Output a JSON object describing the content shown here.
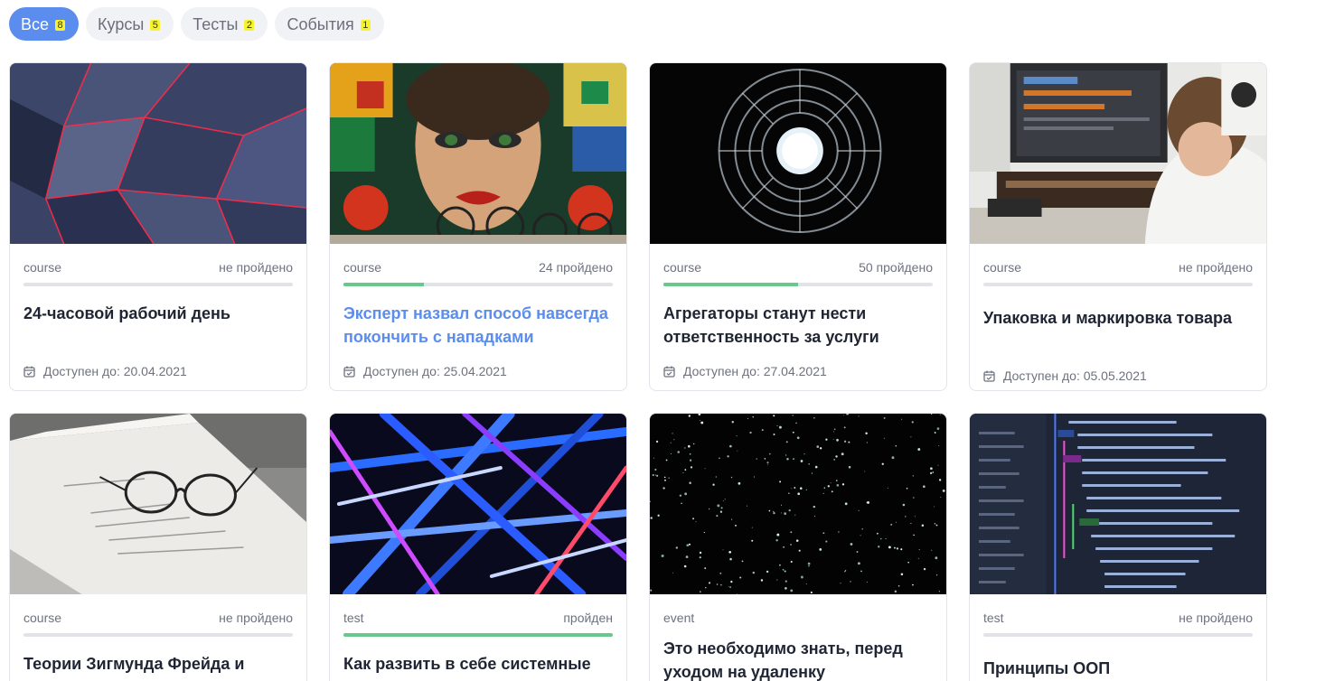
{
  "tabs": [
    {
      "label": "Все",
      "count": "8",
      "active": true
    },
    {
      "label": "Курсы",
      "count": "5"
    },
    {
      "label": "Тесты",
      "count": "2"
    },
    {
      "label": "События",
      "count": "1"
    }
  ],
  "cards": [
    {
      "type": "course",
      "status": "не пройдено",
      "progress": 0,
      "title": "24-часовой рабочий день",
      "date": "Доступен до: 20.04.2021",
      "image": "red-geometric-wall"
    },
    {
      "type": "course",
      "status": "24 пройдено",
      "progress": 0.3,
      "title": "Эксперт назвал способ навсегда покончить с нападками",
      "date": "Доступен до: 25.04.2021",
      "image": "graffiti-face-bicycles"
    },
    {
      "type": "course",
      "status": "50 пройдено",
      "progress": 0.5,
      "title": "Агрегаторы станут нести ответственность за услуги",
      "date": "Доступен до: 27.04.2021",
      "image": "spiral-tunnel-sky"
    },
    {
      "type": "course",
      "status": "не пройдено",
      "progress": 0,
      "title": "Упаковка и маркировка товара",
      "date": "Доступен до: 05.05.2021",
      "image": "music-studio-producer"
    },
    {
      "type": "course",
      "status": "не пройдено",
      "progress": 0,
      "title": "Теории Зигмунда Фрейда и",
      "image": "glasses-on-papers"
    },
    {
      "type": "test",
      "status": "пройден",
      "progress": 1,
      "title": "Как развить в себе системные",
      "image": "neon-tubes-structure"
    },
    {
      "type": "event",
      "status": "",
      "title": "Это необходимо знать, перед уходом на удаленку",
      "image": "starry-night"
    },
    {
      "type": "test",
      "status": "не пройдено",
      "progress": 0,
      "title": "Принципы ООП",
      "image": "git-log-code-screen"
    }
  ],
  "colors": {
    "accent": "#5b8def",
    "progress": "#67c88b",
    "badge": "#f7f32a"
  }
}
